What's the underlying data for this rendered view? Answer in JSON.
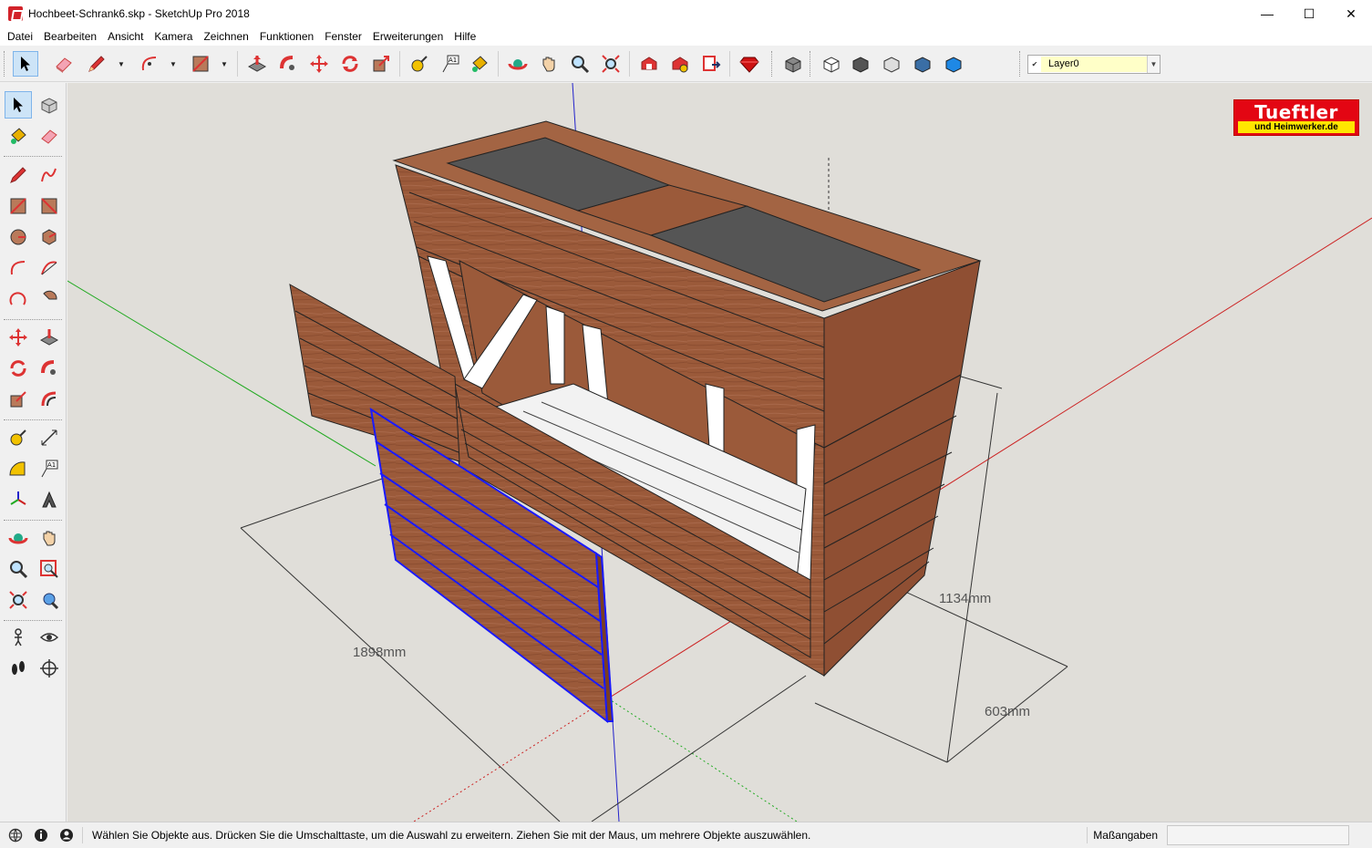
{
  "window": {
    "title": "Hochbeet-Schrank6.skp - SketchUp Pro 2018",
    "minimize_glyph": "—",
    "maximize_glyph": "☐",
    "close_glyph": "✕"
  },
  "menu": {
    "items": [
      {
        "label": "Datei"
      },
      {
        "label": "Bearbeiten"
      },
      {
        "label": "Ansicht"
      },
      {
        "label": "Kamera"
      },
      {
        "label": "Zeichnen"
      },
      {
        "label": "Funktionen"
      },
      {
        "label": "Fenster"
      },
      {
        "label": "Erweiterungen"
      },
      {
        "label": "Hilfe"
      }
    ]
  },
  "toolbar": {
    "layer": {
      "value": "Layer0",
      "check": "✔",
      "arrow": "▼"
    }
  },
  "viewport": {
    "dimensions": {
      "width": "1898mm",
      "height": "1134mm",
      "depth": "603mm"
    },
    "logo": {
      "line1": "Tueftler",
      "line2": "und Heimwerker.de"
    }
  },
  "statusbar": {
    "message": "Wählen Sie Objekte aus. Drücken Sie die Umschalttaste, um die Auswahl zu erweitern. Ziehen Sie mit der Maus, um mehrere Objekte auszuwählen.",
    "measurements_label": "Maßangaben",
    "measurements_value": ""
  },
  "colors": {
    "wood": "#9b5a3a",
    "wood_dark": "#6e3c24",
    "frame": "#ffffff",
    "liner": "#555555",
    "selection": "#1a1aff",
    "axis_red": "#cc2222",
    "axis_green": "#22aa22",
    "axis_blue": "#2222cc",
    "sky": "#e0ded9",
    "active_tool": "#cde4f7"
  }
}
